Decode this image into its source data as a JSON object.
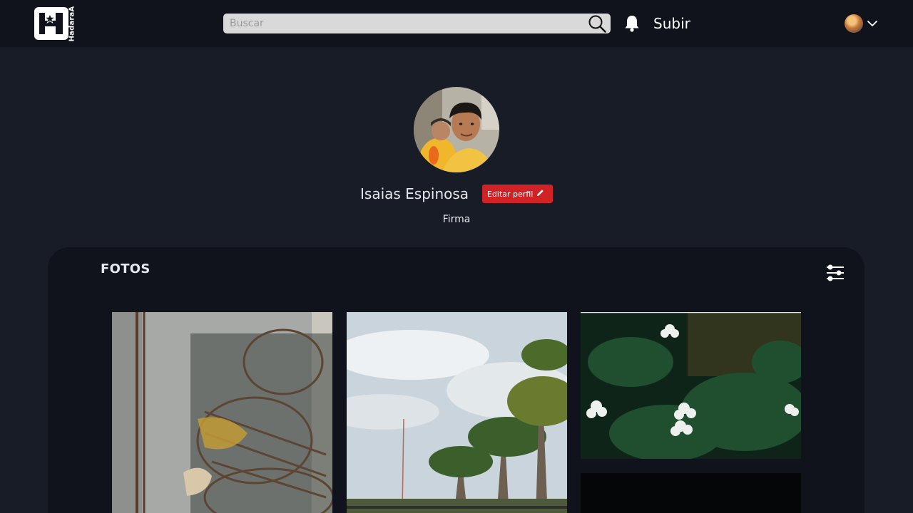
{
  "app": {
    "logo_text": "HadaraA",
    "search": {
      "placeholder": "Buscar",
      "value": ""
    },
    "upload_label": "Subir",
    "icons": {
      "logo": "hadaraa-logo-icon",
      "search": "search-icon",
      "notifications": "bell-icon",
      "user_menu": "chevron-down-icon",
      "edit": "pencil-icon",
      "filter": "sliders-icon"
    }
  },
  "profile": {
    "name": "Isaias Espinosa",
    "edit_label": "Editar perfil",
    "signature": "Firma"
  },
  "photos": {
    "title": "FOTOS",
    "items": [
      {
        "subject": "crab traps against a concrete wall"
      },
      {
        "subject": "palm trees under a cloudy sky"
      },
      {
        "subject": "white periwinkle flowers with green leaves"
      },
      {
        "subject": "dark photo"
      }
    ]
  },
  "colors": {
    "page_bg": "#181c27",
    "header_bg": "#10131c",
    "panel_bg": "#10131c",
    "accent_red": "#d12226",
    "search_bg": "#d9d9d9"
  }
}
